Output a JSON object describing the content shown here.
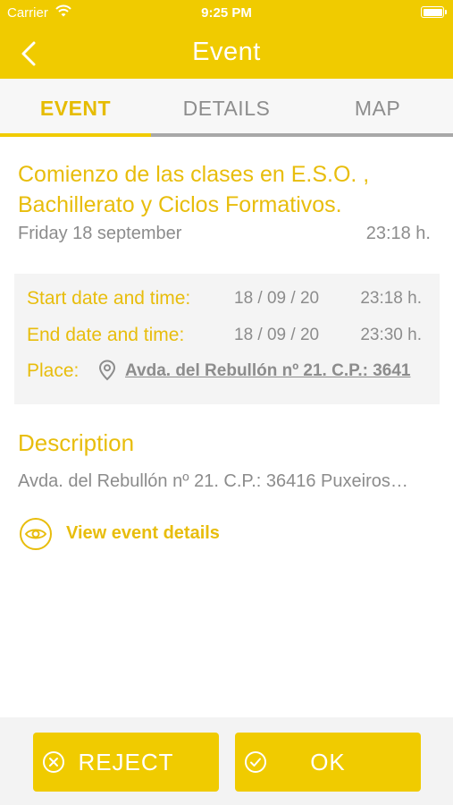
{
  "status_bar": {
    "carrier": "Carrier",
    "time": "9:25 PM"
  },
  "nav": {
    "title": "Event",
    "back_icon": "chevron-left-icon"
  },
  "tabs": [
    {
      "label": "EVENT",
      "active": true
    },
    {
      "label": "DETAILS",
      "active": false
    },
    {
      "label": "MAP",
      "active": false
    }
  ],
  "event": {
    "title": "Comienzo de las clases en E.S.O. , Bachillerato y Ciclos Formativos.",
    "day": "Friday 18 september",
    "time": "23:18 h."
  },
  "info": {
    "start": {
      "label": "Start date and time:",
      "date": "18 / 09 / 20",
      "hour": "23:18 h."
    },
    "end": {
      "label": "End date and time:",
      "date": "18 / 09 / 20",
      "hour": "23:30 h."
    },
    "place": {
      "label": "Place:",
      "value": "Avda. del Rebullón nº 21. C.P.: 3641",
      "icon": "location-pin-icon"
    }
  },
  "description": {
    "heading": "Description",
    "text": "Avda. del Rebullón nº 21. C.P.: 36416 Puxeiros…"
  },
  "view_details": {
    "label": "View event details",
    "icon": "eye-icon"
  },
  "actions": {
    "reject_label": "REJECT",
    "ok_label": "OK"
  },
  "colors": {
    "accent": "#F0CB00",
    "accent_text": "#E8BD0C",
    "muted_text": "#8c8c8c"
  }
}
